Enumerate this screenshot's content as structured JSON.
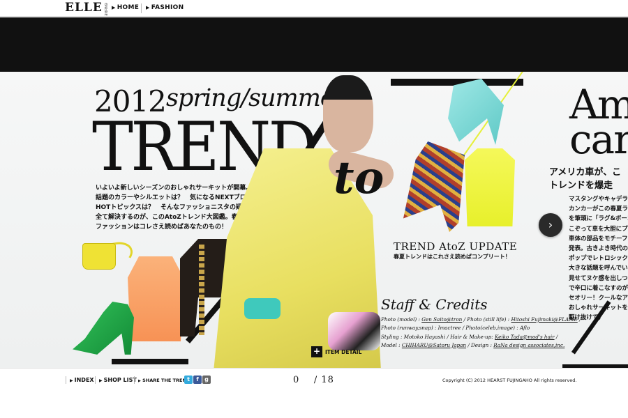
{
  "nav": {
    "logo": "ELLE",
    "logo_sub": "ONLINE",
    "items": [
      {
        "label": "HOME"
      },
      {
        "label": "FASHION"
      }
    ]
  },
  "feature": {
    "year": "2012",
    "season": "spring/summer",
    "trend": "TREND",
    "to": "to",
    "intro_lines": [
      "いよいよ新しいシーズンのおしゃれサーキットが開幕。この春夏、",
      "話題のカラーやシルエットは？　気になるNEXTブロガーや",
      "HOTトピックスは？　そんなファッショニスタの疑問を",
      "全て解決するのが、このAtoZトレンド大図鑑。春夏",
      "ファッションはコレさえ読めばあなたのもの！"
    ],
    "update_title": "TREND AtoZ UPDATE",
    "update_sub": "春夏トレンドはこれさえ読めばコンプリート！",
    "credits_title": "Staff & Credits",
    "credits_lines": [
      {
        "pre": "Photo (model) : ",
        "u1": "Gen Saito@tron",
        "mid": " / Photo (still life) : ",
        "u2": "Hitoshi Fujimaki@FLAME",
        "post": " /"
      },
      {
        "pre": "Photo (runway,snap) : Imactree / Photo(celeb,image) : Aflo",
        "u1": "",
        "mid": "",
        "u2": "",
        "post": ""
      },
      {
        "pre": "Styling : Motoko Hayashi / Hair & Make-up: ",
        "u1": "Keiko Tada@mod's hair",
        "mid": " /",
        "u2": "",
        "post": ""
      },
      {
        "pre": "Model : ",
        "u1": "CHIHARU@Satoru Japan",
        "mid": " / Design : ",
        "u2": "RaNa design associates,inc.",
        "post": ""
      }
    ],
    "item_detail": "ITEM DETAIL",
    "next_icon": "chevron-right-icon"
  },
  "next_panel": {
    "headline_lines": [
      "Am",
      "car"
    ],
    "jp_title_lines": [
      "アメリカ車が、こ",
      "トレンドを爆走"
    ],
    "jp_body_lines": [
      "マスタングやキャデラック",
      "カンカーがこの春夏ランウ",
      "を筆頭に「ラグ&ボーン」",
      "こぞって車を大胆にプリン",
      "車体の部品をモチーフにし",
      "発表。古きよき時代のアメ",
      "ポップでレトロシックな天",
      "大きな話題を呼んでいる。",
      "見せてヌケ感を出しつつ、",
      "で辛口に着こなすのがクー",
      "セオリー！クールなアメ車",
      "おしゃれサーキットを",
      "駆け抜けて。"
    ]
  },
  "footer": {
    "index": "INDEX",
    "shop_list": "SHOP LIST",
    "share": "SHARE THE TREND!",
    "share_icons": [
      "twitter-icon",
      "facebook-icon",
      "google-plus-icon"
    ],
    "page_current": "0",
    "page_sep": "/",
    "page_total": "18",
    "copyright": "Copyright (C) 2012 HEARST FUJINGAHO All rights reserved."
  }
}
